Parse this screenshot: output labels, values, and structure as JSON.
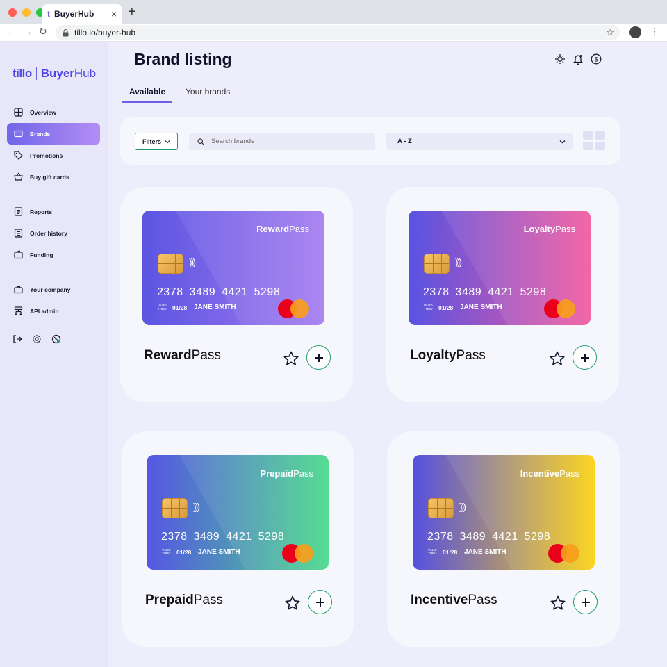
{
  "browser": {
    "tab_title": "BuyerHub",
    "tab_close": "×",
    "new_tab": "+",
    "url": "tillo.io/buyer-hub"
  },
  "sidebar": {
    "logo_brand": "tillo",
    "logo_product_bold": "Buyer",
    "logo_product_rest": "Hub",
    "items": [
      {
        "label": "Overview",
        "icon": "grid-icon"
      },
      {
        "label": "Brands",
        "icon": "card-icon"
      },
      {
        "label": "Promotions",
        "icon": "tag-icon"
      },
      {
        "label": "Buy gift cards",
        "icon": "basket-icon"
      },
      {
        "label": "Reports",
        "icon": "report-icon"
      },
      {
        "label": "Order history",
        "icon": "history-icon"
      },
      {
        "label": "Funding",
        "icon": "wallet-icon"
      },
      {
        "label": "Your company",
        "icon": "briefcase-icon"
      },
      {
        "label": "API admin",
        "icon": "api-icon"
      }
    ],
    "active_index": 1
  },
  "header": {
    "title": "Brand listing"
  },
  "tabs": {
    "available": "Available",
    "your_brands": "Your brands"
  },
  "toolbar": {
    "filters_label": "Filters",
    "search_placeholder": "Search brands",
    "sort_value": "A - Z"
  },
  "brands": [
    {
      "name_bold": "Reward",
      "name_rest": "Pass",
      "number": "2378 3489 4421 5298",
      "valid_label": "VALID THRU",
      "expiry": "01/28",
      "holder": "JANE SMITH",
      "gradient": [
        "#5b55e2",
        "#a57cf0"
      ]
    },
    {
      "name_bold": "Loyalty",
      "name_rest": "Pass",
      "number": "2378 3489 4421 5298",
      "valid_label": "VALID THRU",
      "expiry": "01/28",
      "holder": "JANE SMITH",
      "gradient": [
        "#5853e2",
        "#f25aa0"
      ]
    },
    {
      "name_bold": "Prepaid",
      "name_rest": "Pass",
      "number": "2378 3489 4421 5298",
      "valid_label": "VALID THRU",
      "expiry": "01/28",
      "holder": "JANE SMITH",
      "gradient": [
        "#5656e3",
        "#48d98a"
      ]
    },
    {
      "name_bold": "Incentive",
      "name_rest": "Pass",
      "number": "2378 3489 4421 5298",
      "valid_label": "VALID THRU",
      "expiry": "01/28",
      "holder": "JANE SMITH",
      "gradient": [
        "#5650e0",
        "#fbd20f"
      ]
    }
  ],
  "colors": {
    "accent": "#6d5fe6",
    "action_green": "#1f9d72",
    "background": "#eeedfb"
  }
}
